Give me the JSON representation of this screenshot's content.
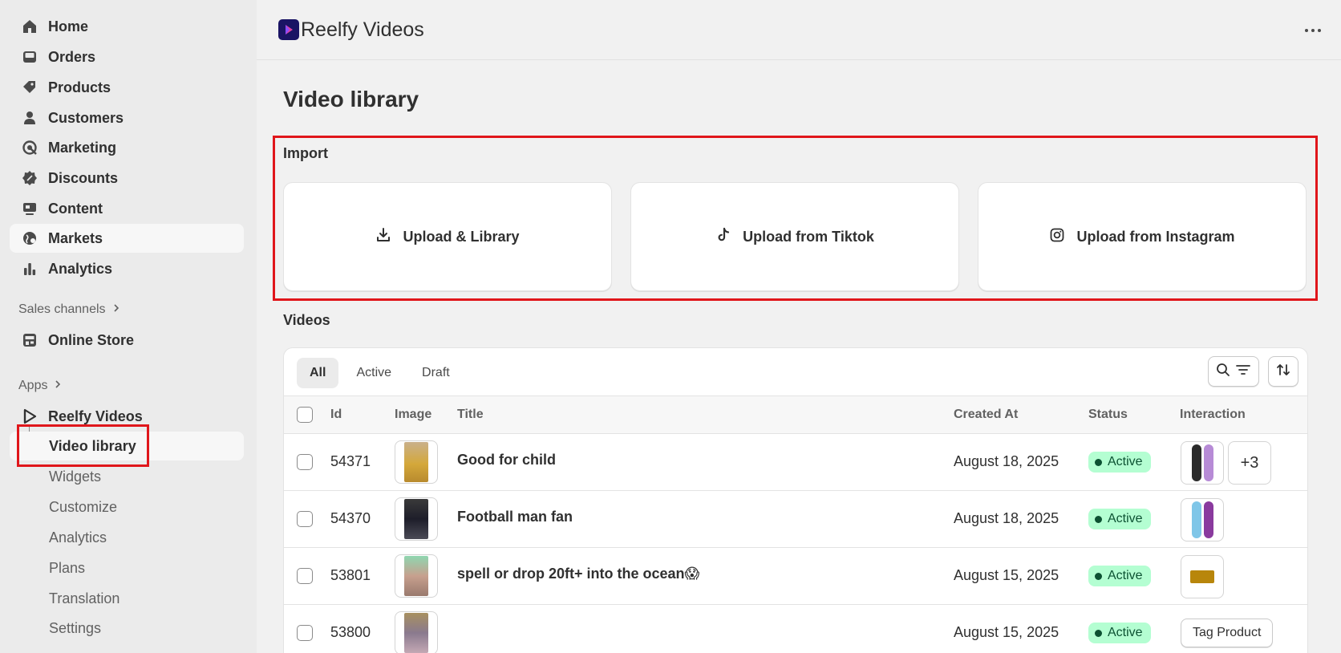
{
  "sidebar": {
    "items": [
      {
        "label": "Home",
        "icon": "home-icon"
      },
      {
        "label": "Orders",
        "icon": "inbox-icon"
      },
      {
        "label": "Products",
        "icon": "tag-icon"
      },
      {
        "label": "Customers",
        "icon": "person-icon"
      },
      {
        "label": "Marketing",
        "icon": "target-icon"
      },
      {
        "label": "Discounts",
        "icon": "discount-icon"
      },
      {
        "label": "Content",
        "icon": "content-icon"
      },
      {
        "label": "Markets",
        "icon": "globe-icon"
      },
      {
        "label": "Analytics",
        "icon": "bar-chart-icon"
      }
    ],
    "sales_channels_label": "Sales channels",
    "online_store_label": "Online Store",
    "apps_label": "Apps",
    "app_name": "Reelfy Videos",
    "app_subitems": [
      "Video library",
      "Widgets",
      "Customize",
      "Analytics",
      "Plans",
      "Translation",
      "Settings"
    ]
  },
  "topbar": {
    "title": "Reelfy Videos"
  },
  "page": {
    "title": "Video library"
  },
  "import": {
    "label": "Import",
    "cards": [
      {
        "label": "Upload & Library",
        "icon": "download-icon"
      },
      {
        "label": "Upload from Tiktok",
        "icon": "tiktok-icon"
      },
      {
        "label": "Upload from Instagram",
        "icon": "instagram-icon"
      }
    ]
  },
  "videos": {
    "label": "Videos",
    "tabs": [
      "All",
      "Active",
      "Draft"
    ],
    "columns": [
      "Id",
      "Image",
      "Title",
      "Created At",
      "Status",
      "Interaction"
    ],
    "rows": [
      {
        "id": "54371",
        "title": "Good for child",
        "created": "August 18, 2025",
        "status": "Active",
        "more": "+3"
      },
      {
        "id": "54370",
        "title": "Football man fan",
        "created": "August 18, 2025",
        "status": "Active"
      },
      {
        "id": "53801",
        "title": "spell or drop 20ft+ into the ocean😱",
        "created": "August 15, 2025",
        "status": "Active"
      },
      {
        "id": "53800",
        "title": "",
        "created": "August 15, 2025",
        "status": "Active",
        "tag_label": "Tag Product"
      }
    ]
  },
  "colors": {
    "highlight": "#e0161b",
    "active_badge": "#b4fed2",
    "active_text": "#0c5132"
  }
}
